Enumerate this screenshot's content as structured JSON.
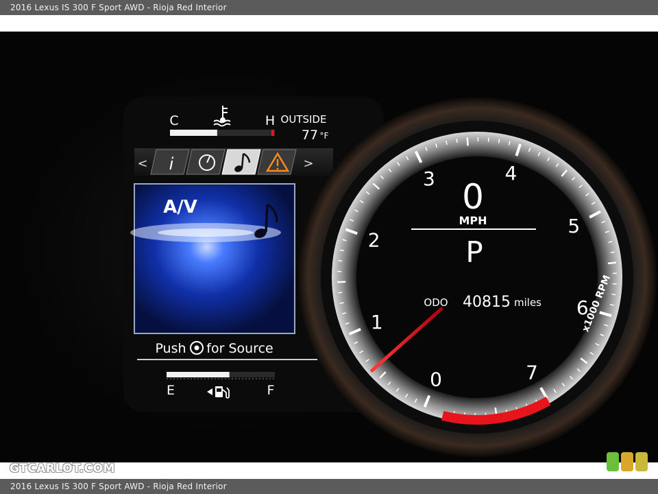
{
  "caption": "2016 Lexus IS 300 F Sport AWD - Rioja Red Interior",
  "watermark": "GTCARLOT.COM",
  "cluster": {
    "temp": {
      "cold": "C",
      "hot": "H",
      "outside_label": "OUTSIDE",
      "outside_value": "77",
      "unit": "°F",
      "gauge_level": 0.45
    },
    "tabs": {
      "prev": "<",
      "info": "i",
      "next": ">"
    },
    "av_panel": {
      "title": "A/V",
      "hint_prefix": "Push",
      "hint_suffix": "for Source"
    },
    "fuel": {
      "empty": "E",
      "full": "F",
      "level": 0.58
    },
    "tach": {
      "ticks": [
        "0",
        "1",
        "2",
        "3",
        "4",
        "5",
        "6",
        "7"
      ],
      "speed": "0",
      "speed_unit": "MPH",
      "gear": "P",
      "odo_label": "ODO",
      "odo_value": "40815",
      "odo_unit": "miles",
      "rpm_unit": "x1000 RPM",
      "redline_from": 7.0,
      "needle_rpm": 0.6
    }
  },
  "colors": {
    "redline": "#e8141c",
    "needle": "#ff2a2a",
    "av_blue": "#2a5cff",
    "warning": "#ff8a1c"
  }
}
